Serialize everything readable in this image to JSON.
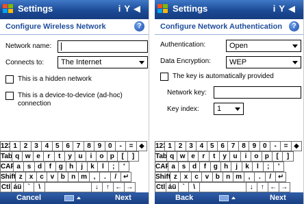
{
  "left": {
    "title": "Settings",
    "heading": "Configure Wireless Network",
    "network_name_label": "Network name:",
    "network_name_value": "",
    "connects_to_label": "Connects to:",
    "connects_to_value": "The Internet",
    "hidden_network_label": "This is a hidden network",
    "hidden_network_checked": false,
    "adhoc_label": "This is a device-to-device (ad-hoc) connection",
    "adhoc_checked": false,
    "softkey_left": "Cancel",
    "softkey_right": "Next"
  },
  "right": {
    "title": "Settings",
    "heading": "Configure Network Authentication",
    "authentication_label": "Authentication:",
    "authentication_value": "Open",
    "encryption_label": "Data Encryption:",
    "encryption_value": "WEP",
    "auto_key_label": "The key is automatically provided",
    "auto_key_checked": false,
    "network_key_label": "Network key:",
    "network_key_value": "",
    "key_index_label": "Key index:",
    "key_index_value": "1",
    "softkey_left": "Back",
    "softkey_right": "Next"
  },
  "status_icons": [
    "signal-antenna-icon",
    "connectivity-icon",
    "volume-icon"
  ],
  "keyboard": {
    "rows": [
      [
        "123",
        "1",
        "2",
        "3",
        "4",
        "5",
        "6",
        "7",
        "8",
        "9",
        "0",
        "-",
        "=",
        "◆"
      ],
      [
        "Tab",
        "q",
        "w",
        "e",
        "r",
        "t",
        "y",
        "u",
        "i",
        "o",
        "p",
        "[",
        "]"
      ],
      [
        "CAP",
        "a",
        "s",
        "d",
        "f",
        "g",
        "h",
        "j",
        "k",
        "l",
        ";",
        "'"
      ],
      [
        "Shift",
        "z",
        "x",
        "c",
        "v",
        "b",
        "n",
        "m",
        ",",
        ".",
        "/",
        "↵"
      ],
      [
        "Ctl",
        "áü",
        "`",
        "\\",
        " ",
        "↓",
        "↑",
        "←",
        "→"
      ]
    ]
  },
  "colors": {
    "titlebar": "#1c4a95",
    "heading": "#1f4e9c",
    "menubar": "#183e82"
  }
}
